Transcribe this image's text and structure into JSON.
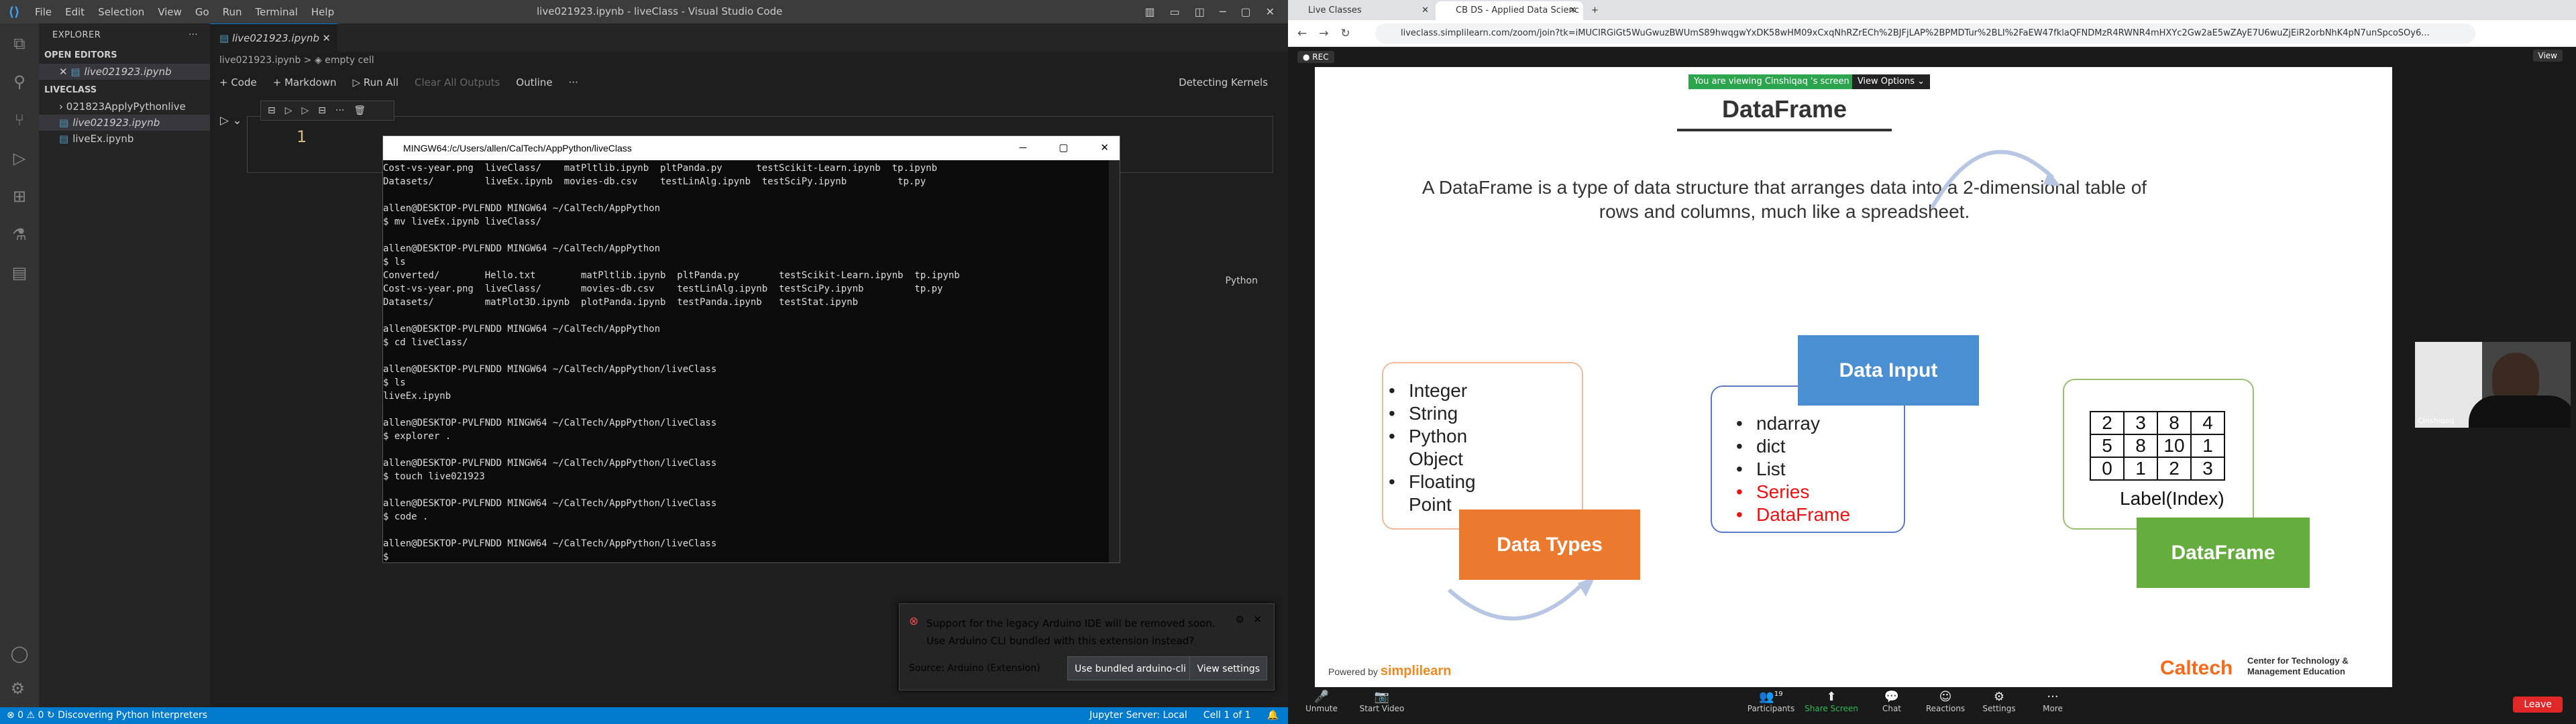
{
  "vscode": {
    "menu": [
      "File",
      "Edit",
      "Selection",
      "View",
      "Go",
      "Run",
      "Terminal",
      "Help"
    ],
    "window_title": "live021923.ipynb - liveClass - Visual Studio Code",
    "explorer_title": "EXPLORER",
    "open_editors": "OPEN EDITORS",
    "open_file": "live021923.ipynb",
    "folder": "LIVECLASS",
    "files": [
      "021823ApplyPythonlive",
      "live021923.ipynb",
      "liveEx.ipynb"
    ],
    "tab": "live021923.ipynb",
    "breadcrumb": "live021923.ipynb > ◈ empty cell",
    "toolbar": {
      "code": "+ Code",
      "markdown": "+ Markdown",
      "run_all": "▷ Run All",
      "clear": "Clear All Outputs",
      "outline": "Outline",
      "kernels": "Detecting Kernels"
    },
    "cell_line": "1",
    "cell_lang": "Python",
    "status": {
      "left": "⊗ 0 ⚠ 0  ↻ Discovering Python Interpreters",
      "jupyter": "Jupyter Server: Local",
      "cell": "Cell 1 of 1"
    }
  },
  "terminal": {
    "title": "MINGW64:/c/Users/allen/CalTech/AppPython/liveClass",
    "lines": [
      "Cost-vs-year.png  liveClass/    matPltlib.ipynb  pltPanda.py      testScikit-Learn.ipynb  tp.ipynb",
      "Datasets/         liveEx.ipynb  movies-db.csv    testLinAlg.ipynb  testSciPy.ipynb         tp.py",
      "",
      "allen@DESKTOP-PVLFNDD MINGW64 ~/CalTech/AppPython",
      "$ mv liveEx.ipynb liveClass/",
      "",
      "allen@DESKTOP-PVLFNDD MINGW64 ~/CalTech/AppPython",
      "$ ls",
      "Converted/        Hello.txt        matPltlib.ipynb  pltPanda.py       testScikit-Learn.ipynb  tp.ipynb",
      "Cost-vs-year.png  liveClass/       movies-db.csv    testLinAlg.ipynb  testSciPy.ipynb         tp.py",
      "Datasets/         matPlot3D.ipynb  plotPanda.ipynb  testPanda.ipynb   testStat.ipynb",
      "",
      "allen@DESKTOP-PVLFNDD MINGW64 ~/CalTech/AppPython",
      "$ cd liveClass/",
      "",
      "allen@DESKTOP-PVLFNDD MINGW64 ~/CalTech/AppPython/liveClass",
      "$ ls",
      "liveEx.ipynb",
      "",
      "allen@DESKTOP-PVLFNDD MINGW64 ~/CalTech/AppPython/liveClass",
      "$ explorer .",
      "",
      "allen@DESKTOP-PVLFNDD MINGW64 ~/CalTech/AppPython/liveClass",
      "$ touch live021923",
      "",
      "allen@DESKTOP-PVLFNDD MINGW64 ~/CalTech/AppPython/liveClass",
      "$ code .",
      "",
      "allen@DESKTOP-PVLFNDD MINGW64 ~/CalTech/AppPython/liveClass",
      "$"
    ]
  },
  "notification": {
    "message": "Support for the legacy Arduino IDE will be removed soon. Use Arduino CLI bundled with this extension instead?",
    "source": "Source: Arduino (Extension)",
    "btn1": "Use bundled arduino-cli",
    "btn2": "View settings"
  },
  "browser": {
    "tabs": [
      "Live Classes",
      "CB DS - Applied Data Scienc"
    ],
    "url": "liveclass.simplilearn.com/zoom/join?tk=iMUCIRGiGt5WuGwuzBWUmS89hwqgwYxDK58wHM09xCxqNhRZrECh%2BJFjLAP%2BPMDTur%2BLI%2FaEW47fklaQFNDMzR4RWNR4mHXYc2Gw2aE5wZAyE7U6wuZjEiR2orbNhK4pN7unSpcoSOy6..."
  },
  "zoom": {
    "rec": "● REC",
    "view": "View",
    "banner": "You are viewing Cinshiqaq 's screen",
    "view_options": "View Options ⌄",
    "participant": "Cinshiqaq",
    "bar": [
      "Unmute",
      "Start Video",
      "Participants",
      "Share Screen",
      "Chat",
      "Reactions",
      "Settings",
      "More"
    ],
    "participants_count": "19",
    "leave": "Leave"
  },
  "slide": {
    "title": "DataFrame",
    "paragraph": "A DataFrame is a type of data structure that arranges data into a 2-dimensional table of rows and columns, much like a spreadsheet.",
    "types": [
      "Integer",
      "String",
      "Python Object",
      "Floating Point"
    ],
    "types_label": "Data Types",
    "input_label": "Data Input",
    "inputs": [
      "ndarray",
      "dict",
      "List",
      "Series",
      "DataFrame"
    ],
    "df_label": "DataFrame",
    "grid": [
      [
        "2",
        "3",
        "8",
        "4"
      ],
      [
        "5",
        "8",
        "10",
        "1"
      ],
      [
        "0",
        "1",
        "2",
        "3"
      ]
    ],
    "index_label": "Label(Index)",
    "powered": "Powered by",
    "brand": "simplilearn",
    "caltech": "Caltech",
    "caltech_sub": "Center for Technology & Management Education"
  }
}
